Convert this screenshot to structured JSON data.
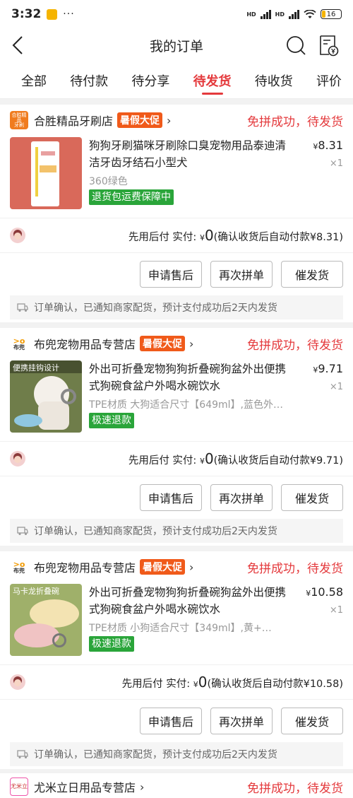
{
  "status_bar": {
    "time": "3:32",
    "dots": "···",
    "battery": "16"
  },
  "header": {
    "title": "我的订单"
  },
  "tabs": [
    {
      "label": "全部"
    },
    {
      "label": "待付款"
    },
    {
      "label": "待分享"
    },
    {
      "label": "待发货",
      "active": true
    },
    {
      "label": "待收货"
    },
    {
      "label": "评价"
    }
  ],
  "orders": [
    {
      "shop": "合胜精品牙刷店",
      "promo": "暑假大促",
      "status": "免拼成功，待发货",
      "product_title": "狗狗牙刷猫咪牙刷除口臭宠物用品泰迪清洁牙齿牙结石小型犬",
      "spec": "360绿色",
      "tag": "退货包运费保障中",
      "price_symbol": "¥",
      "price": "8.31",
      "qty": "×1",
      "pay_label": "先用后付 实付:",
      "pay_symbol": "¥",
      "pay_amount": "0",
      "pay_note": "(确认收货后自动付款¥8.31)",
      "btn_after_sale": "申请售后",
      "btn_rebuy": "再次拼单",
      "btn_urge": "催发货",
      "notice": "订单确认，已通知商家配货，预计支付成功后2天内发货"
    },
    {
      "shop": "布兜宠物用品专营店",
      "promo": "暑假大促",
      "status": "免拼成功，待发货",
      "product_title": "外出可折叠宠物狗狗折叠碗狗盆外出便携式狗碗食盆户外喝水碗饮水",
      "spec": "TPE材质 大狗适合尺寸【649ml】,蓝色外…",
      "tag": "极速退款",
      "thumb_text": "便携挂钩设计",
      "price_symbol": "¥",
      "price": "9.71",
      "qty": "×1",
      "pay_label": "先用后付 实付:",
      "pay_symbol": "¥",
      "pay_amount": "0",
      "pay_note": "(确认收货后自动付款¥9.71)",
      "btn_after_sale": "申请售后",
      "btn_rebuy": "再次拼单",
      "btn_urge": "催发货",
      "notice": "订单确认，已通知商家配货，预计支付成功后2天内发货"
    },
    {
      "shop": "布兜宠物用品专营店",
      "promo": "暑假大促",
      "status": "免拼成功，待发货",
      "product_title": "外出可折叠宠物狗狗折叠碗狗盆外出便携式狗碗食盆户外喝水碗饮水",
      "spec": "TPE材质 小狗适合尺寸【349ml】,黄+…",
      "tag": "极速退款",
      "thumb_text": "马卡龙折叠碗",
      "price_symbol": "¥",
      "price": "10.58",
      "qty": "×1",
      "pay_label": "先用后付 实付:",
      "pay_symbol": "¥",
      "pay_amount": "0",
      "pay_note": "(确认收货后自动付款¥10.58)",
      "btn_after_sale": "申请售后",
      "btn_rebuy": "再次拼单",
      "btn_urge": "催发货",
      "notice": "订单确认，已通知商家配货，预计支付成功后2天内发货"
    },
    {
      "shop": "尤米立日用品专营店",
      "status": "免拼成功，待发货"
    }
  ],
  "icons": {
    "back": "back-arrow-icon",
    "search": "search-icon",
    "bill": "bill-yuan-icon",
    "notice": "truck-icon"
  },
  "colors": {
    "accent": "#e4393c",
    "promo": "#f05a1a",
    "tag_green": "#2aa53a"
  }
}
